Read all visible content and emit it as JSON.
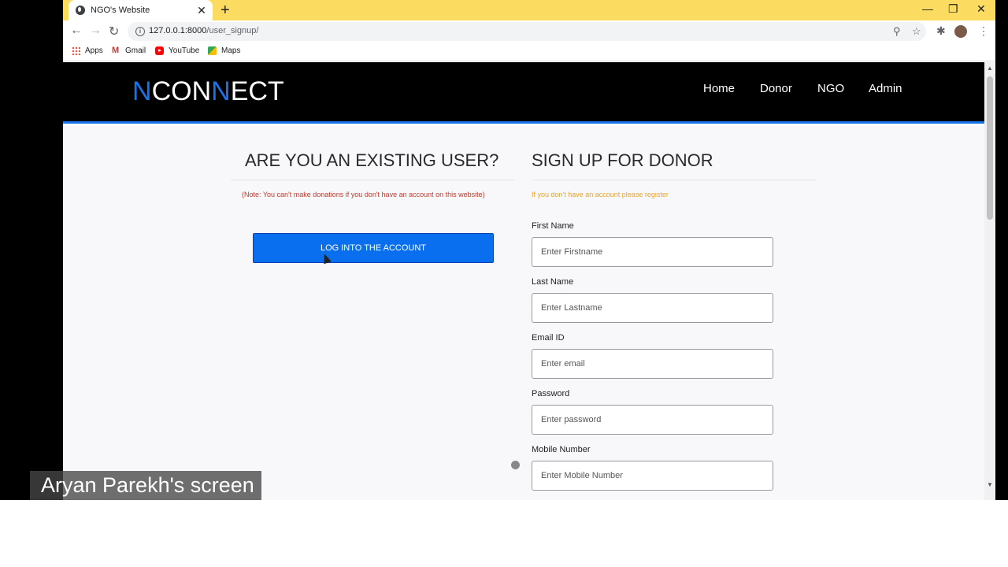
{
  "browser": {
    "tab_title": "NGO's Website",
    "tab_close": "✕",
    "new_tab": "+",
    "window_controls": {
      "minimize": "—",
      "restore": "❐",
      "close": "✕"
    },
    "nav": {
      "back": "←",
      "forward": "→",
      "reload": "↻"
    },
    "url_host": "127.0.0.1:8000",
    "url_path": "/user_signup/",
    "omnibox_icons": [
      "zoom-icon",
      "star-icon"
    ],
    "toolbar_icons": [
      "extensions-icon",
      "profile-avatar",
      "menu-icon"
    ]
  },
  "bookmarks": [
    {
      "label": "Apps",
      "icon": "apps-icon"
    },
    {
      "label": "Gmail",
      "icon": "gmail-icon"
    },
    {
      "label": "YouTube",
      "icon": "youtube-icon"
    },
    {
      "label": "Maps",
      "icon": "maps-icon"
    }
  ],
  "site": {
    "logo_parts": [
      "N",
      "CON",
      "N",
      "ECT"
    ],
    "nav": [
      "Home",
      "Donor",
      "NGO",
      "Admin"
    ],
    "accent_color": "#1a73e8"
  },
  "existing_user": {
    "heading": "ARE YOU AN EXISTING USER?",
    "note": "(Note: You can't make donations if you don't have an account on this website)",
    "login_button": "LOG INTO THE ACCOUNT"
  },
  "signup": {
    "heading": "SIGN UP FOR DONOR",
    "note": "If you don't have an account please register",
    "fields": [
      {
        "label": "First Name",
        "placeholder": "Enter Firstname"
      },
      {
        "label": "Last Name",
        "placeholder": "Enter Lastname"
      },
      {
        "label": "Email ID",
        "placeholder": "Enter email"
      },
      {
        "label": "Password",
        "placeholder": "Enter password"
      },
      {
        "label": "Mobile Number",
        "placeholder": "Enter Mobile Number"
      }
    ]
  },
  "caption": "Aryan Parekh's screen"
}
